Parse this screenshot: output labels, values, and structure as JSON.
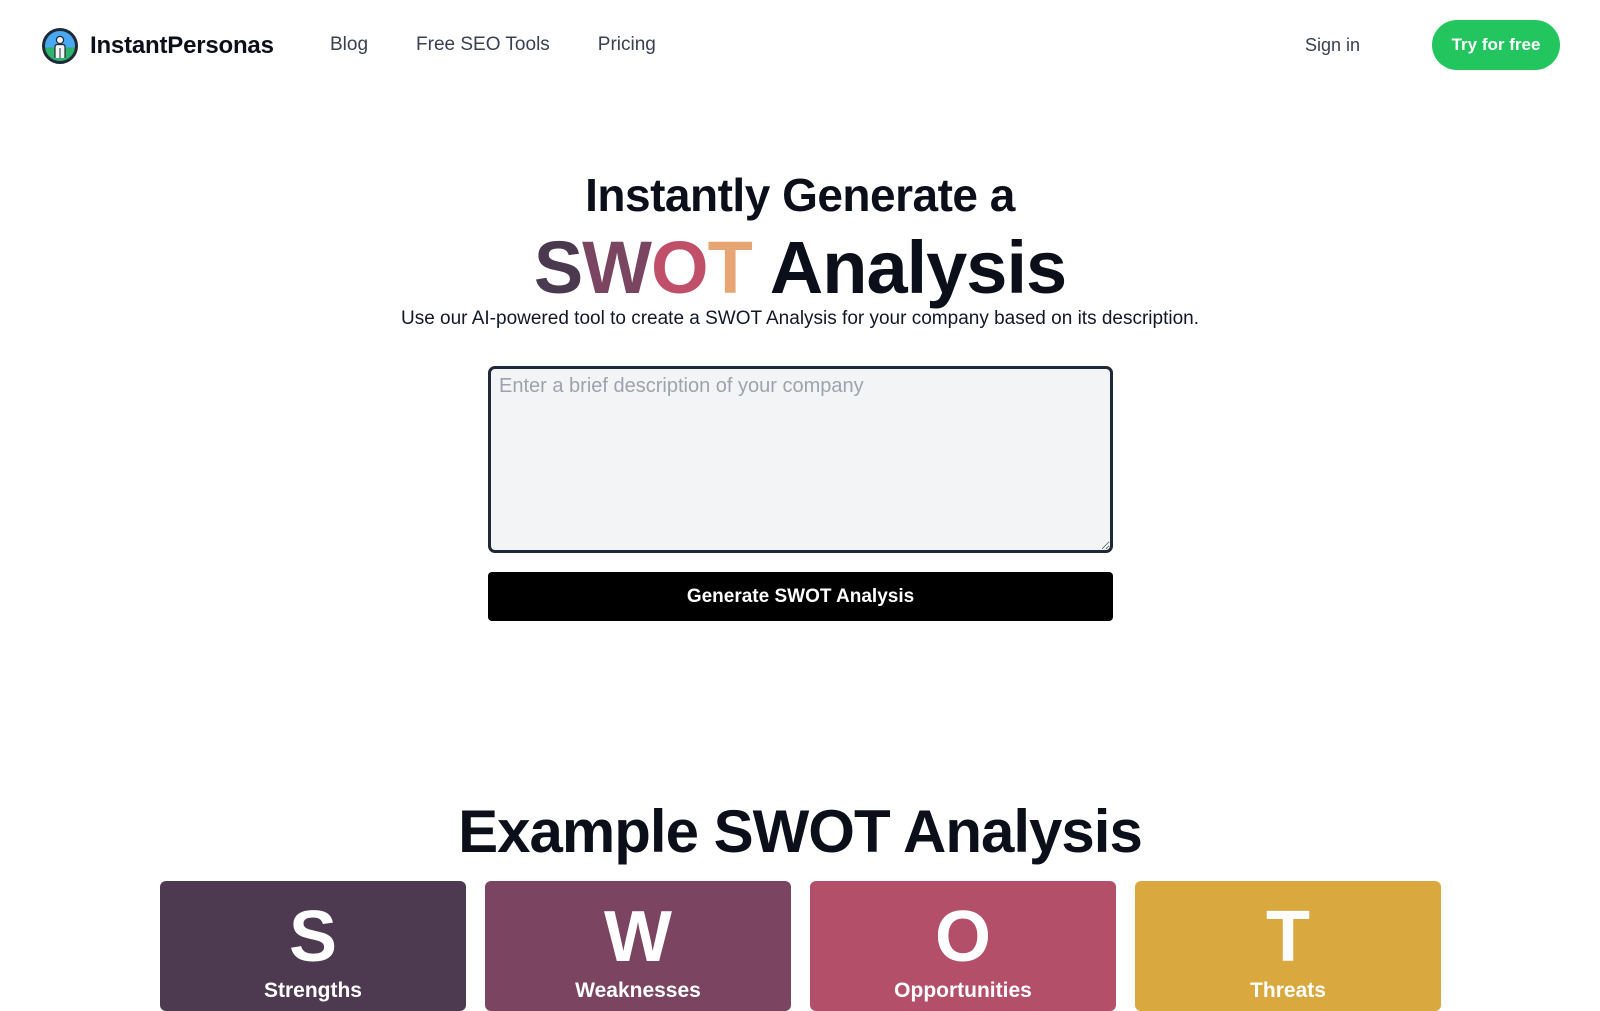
{
  "nav": {
    "brand": "InstantPersonas",
    "links": [
      "Blog",
      "Free SEO Tools",
      "Pricing"
    ],
    "sign_in": "Sign in",
    "cta": "Try for free"
  },
  "hero": {
    "line1": "Instantly Generate a",
    "swot_letters": [
      {
        "char": "S",
        "color": "#4b3950"
      },
      {
        "char": "W",
        "color": "#7a4560"
      },
      {
        "char": "O",
        "color": "#c04f6a"
      },
      {
        "char": "T",
        "color": "#e8a574"
      }
    ],
    "analysis_word": "Analysis",
    "subtitle": "Use our AI-powered tool to create a SWOT Analysis for your company based on its description."
  },
  "form": {
    "placeholder": "Enter a brief description of your company",
    "value": "",
    "button": "Generate SWOT Analysis"
  },
  "example": {
    "title": "Example SWOT Analysis",
    "cards": [
      {
        "letter": "S",
        "label": "Strengths",
        "color": "#4d3a50"
      },
      {
        "letter": "W",
        "label": "Weaknesses",
        "color": "#7b4562"
      },
      {
        "letter": "O",
        "label": "Opportunities",
        "color": "#b44f6a"
      },
      {
        "letter": "T",
        "label": "Threats",
        "color": "#d9a83e"
      }
    ]
  },
  "colors": {
    "accent_green": "#22c55e",
    "button_black": "#000000"
  }
}
